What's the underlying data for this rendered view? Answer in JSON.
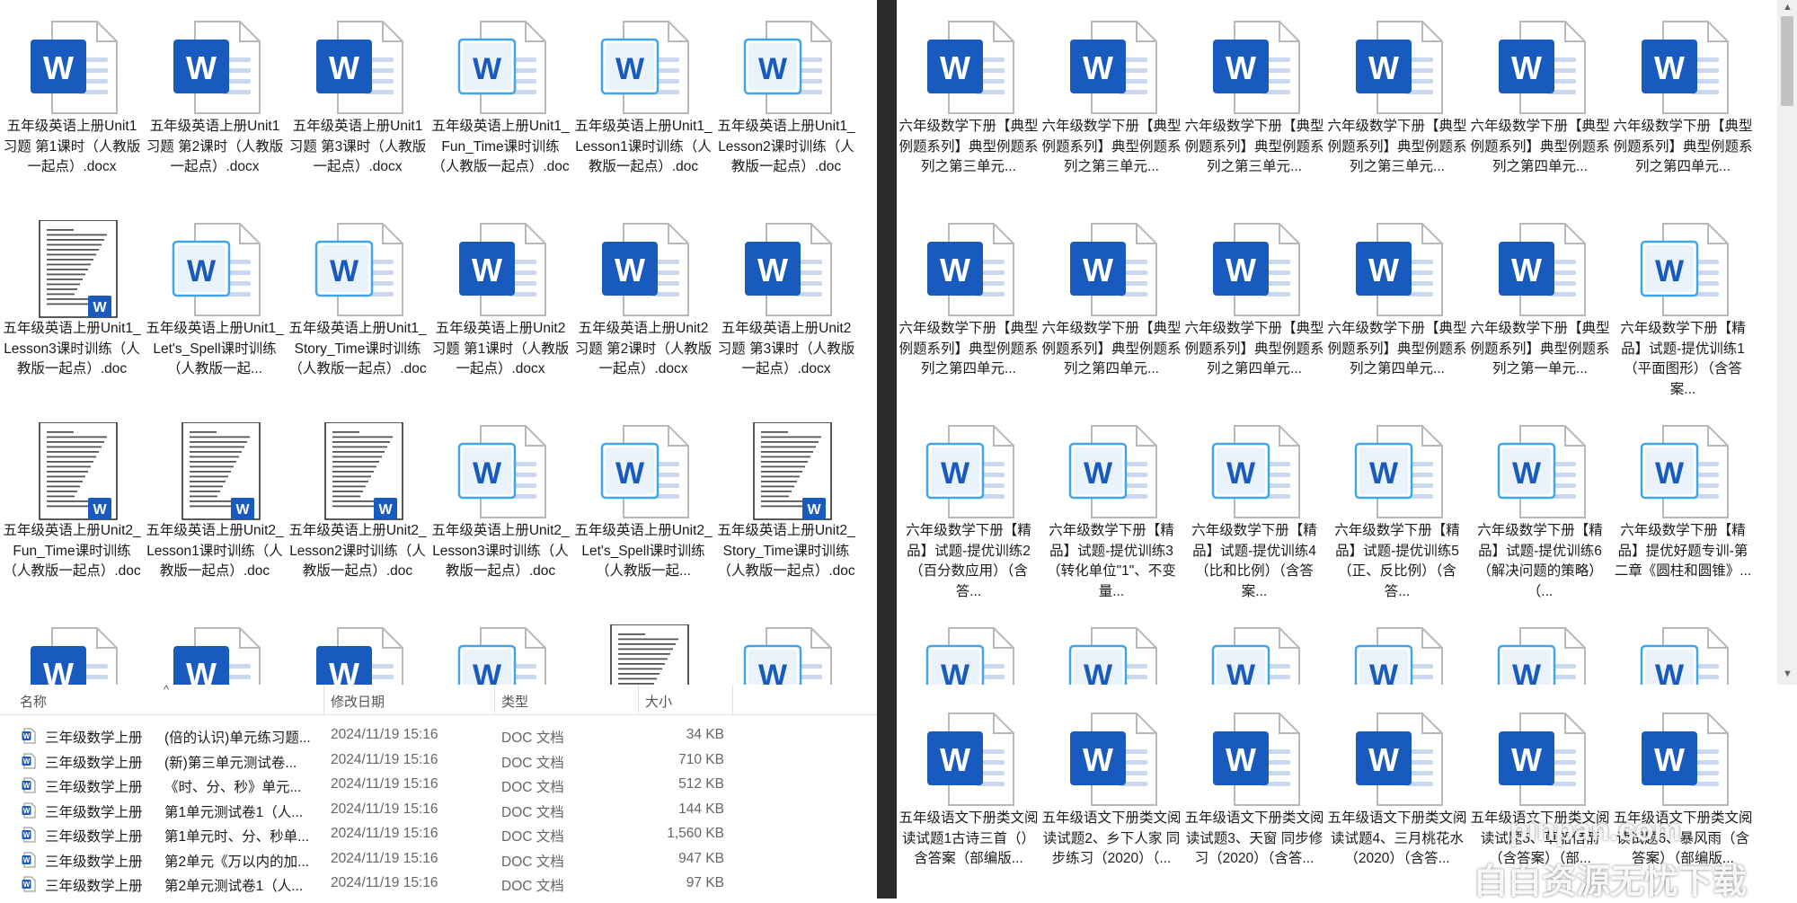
{
  "left_grid": [
    {
      "caption": "五年级英语上册Unit1 习题 第1课时（人教版一起点）.docx",
      "style": "solid"
    },
    {
      "caption": "五年级英语上册Unit1 习题 第2课时（人教版一起点）.docx",
      "style": "solid"
    },
    {
      "caption": "五年级英语上册Unit1 习题 第3课时（人教版一起点）.docx",
      "style": "solid"
    },
    {
      "caption": "五年级英语上册Unit1_Fun_Time课时训练（人教版一起点）.doc",
      "style": "outline"
    },
    {
      "caption": "五年级英语上册Unit1_Lesson1课时训练（人教版一起点）.doc",
      "style": "outline"
    },
    {
      "caption": "五年级英语上册Unit1_Lesson2课时训练（人教版一起点）.doc",
      "style": "outline"
    },
    {
      "caption": "五年级英语上册Unit1_Lesson3课时训练（人教版一起点）.doc",
      "style": "thumb"
    },
    {
      "caption": "五年级英语上册Unit1_Let's_Spell课时训练（人教版一起...",
      "style": "outline"
    },
    {
      "caption": "五年级英语上册Unit1_Story_Time课时训练（人教版一起点）.doc",
      "style": "outline"
    },
    {
      "caption": "五年级英语上册Unit2 习题 第1课时（人教版一起点）.docx",
      "style": "solid"
    },
    {
      "caption": "五年级英语上册Unit2 习题 第2课时（人教版一起点）.docx",
      "style": "solid"
    },
    {
      "caption": "五年级英语上册Unit2 习题 第3课时（人教版一起点）.docx",
      "style": "solid"
    },
    {
      "caption": "五年级英语上册Unit2_Fun_Time课时训练（人教版一起点）.doc",
      "style": "thumb"
    },
    {
      "caption": "五年级英语上册Unit2_Lesson1课时训练（人教版一起点）.doc",
      "style": "thumb"
    },
    {
      "caption": "五年级英语上册Unit2_Lesson2课时训练（人教版一起点）.doc",
      "style": "thumb"
    },
    {
      "caption": "五年级英语上册Unit2_Lesson3课时训练（人教版一起点）.doc",
      "style": "outline"
    },
    {
      "caption": "五年级英语上册Unit2_Let's_Spell课时训练（人教版一起...",
      "style": "outline"
    },
    {
      "caption": "五年级英语上册Unit2_Story_Time课时训练（人教版一起点）.doc",
      "style": "thumb"
    },
    {
      "caption": "",
      "style": "solid"
    },
    {
      "caption": "",
      "style": "solid"
    },
    {
      "caption": "",
      "style": "solid"
    },
    {
      "caption": "",
      "style": "outline"
    },
    {
      "caption": "",
      "style": "thumb"
    },
    {
      "caption": "",
      "style": "outline"
    }
  ],
  "right_grid": [
    {
      "caption": "六年级数学下册【典型例题系列】典型例题系列之第三单元...",
      "style": "solid"
    },
    {
      "caption": "六年级数学下册【典型例题系列】典型例题系列之第三单元...",
      "style": "solid"
    },
    {
      "caption": "六年级数学下册【典型例题系列】典型例题系列之第三单元...",
      "style": "solid"
    },
    {
      "caption": "六年级数学下册【典型例题系列】典型例题系列之第三单元...",
      "style": "solid"
    },
    {
      "caption": "六年级数学下册【典型例题系列】典型例题系列之第四单元...",
      "style": "solid"
    },
    {
      "caption": "六年级数学下册【典型例题系列】典型例题系列之第四单元...",
      "style": "solid"
    },
    {
      "caption": "六年级数学下册【典型例题系列】典型例题系列之第四单元...",
      "style": "solid"
    },
    {
      "caption": "六年级数学下册【典型例题系列】典型例题系列之第四单元...",
      "style": "solid"
    },
    {
      "caption": "六年级数学下册【典型例题系列】典型例题系列之第四单元...",
      "style": "solid"
    },
    {
      "caption": "六年级数学下册【典型例题系列】典型例题系列之第四单元...",
      "style": "solid"
    },
    {
      "caption": "六年级数学下册【典型例题系列】典型例题系列之第一单元...",
      "style": "solid"
    },
    {
      "caption": "六年级数学下册【精品】试题-提优训练1（平面图形）（含答案...",
      "style": "outline"
    },
    {
      "caption": "六年级数学下册【精品】试题-提优训练2（百分数应用）（含答...",
      "style": "outline"
    },
    {
      "caption": "六年级数学下册【精品】试题-提优训练3（转化单位\"1\"、不变量...",
      "style": "outline"
    },
    {
      "caption": "六年级数学下册【精品】试题-提优训练4（比和比例）（含答案...",
      "style": "outline"
    },
    {
      "caption": "六年级数学下册【精品】试题-提优训练5（正、反比例）（含答...",
      "style": "outline"
    },
    {
      "caption": "六年级数学下册【精品】试题-提优训练6（解决问题的策略）（...",
      "style": "outline"
    },
    {
      "caption": "六年级数学下册【精品】提优好题专训-第二章《圆柱和圆锥》...",
      "style": "outline"
    },
    {
      "caption": "",
      "style": "outline"
    },
    {
      "caption": "",
      "style": "outline"
    },
    {
      "caption": "",
      "style": "outline"
    },
    {
      "caption": "",
      "style": "outline"
    },
    {
      "caption": "",
      "style": "outline"
    },
    {
      "caption": "",
      "style": "outline"
    }
  ],
  "bottom_right_grid": [
    {
      "caption": "五年级语文下册类文阅读试题1古诗三首（）含答案（部编版...",
      "style": "solid"
    },
    {
      "caption": "五年级语文下册类文阅读试题2、乡下人家 同步练习（2020）（...",
      "style": "solid"
    },
    {
      "caption": "五年级语文下册类文阅读试题3、天窗 同步修习（2020）（含答...",
      "style": "solid"
    },
    {
      "caption": "五年级语文下册类文阅读试题4、三月桃花水（2020）（含答...",
      "style": "solid"
    },
    {
      "caption": "五年级语文下册类文阅读试题5、草船借箭（含答案）（部...",
      "style": "solid"
    },
    {
      "caption": "五年级语文下册类文阅读试题6、暴风雨（含答案）（部编版...",
      "style": "solid"
    }
  ],
  "details": {
    "headers": {
      "name": "名称",
      "date": "修改日期",
      "type": "类型",
      "size": "大小"
    },
    "rows": [
      {
        "name": "三年级数学上册",
        "desc": "(倍的认识)单元练习题...",
        "date": "2024/11/19 15:16",
        "type": "DOC 文档",
        "size": "34 KB"
      },
      {
        "name": "三年级数学上册",
        "desc": "(新)第三单元测试卷...",
        "date": "2024/11/19 15:16",
        "type": "DOC 文档",
        "size": "710 KB"
      },
      {
        "name": "三年级数学上册",
        "desc": "《时、分、秒》单元...",
        "date": "2024/11/19 15:16",
        "type": "DOC 文档",
        "size": "512 KB"
      },
      {
        "name": "三年级数学上册",
        "desc": "第1单元测试卷1（人...",
        "date": "2024/11/19 15:16",
        "type": "DOC 文档",
        "size": "144 KB"
      },
      {
        "name": "三年级数学上册",
        "desc": "第1单元时、分、秒单...",
        "date": "2024/11/19 15:16",
        "type": "DOC 文档",
        "size": "1,560 KB"
      },
      {
        "name": "三年级数学上册",
        "desc": "第2单元《万以内的加...",
        "date": "2024/11/19 15:16",
        "type": "DOC 文档",
        "size": "947 KB"
      },
      {
        "name": "三年级数学上册",
        "desc": "第2单元测试卷1（人...",
        "date": "2024/11/19 15:16",
        "type": "DOC 文档",
        "size": "97 KB"
      }
    ]
  },
  "watermark": {
    "line1": "pinpan.com",
    "line2": "白白资源无忧下载"
  },
  "colors": {
    "word_blue": "#185abd",
    "word_light": "#41a5ee",
    "page_border": "#b8b8b8",
    "divider": "#2b2b2b"
  }
}
